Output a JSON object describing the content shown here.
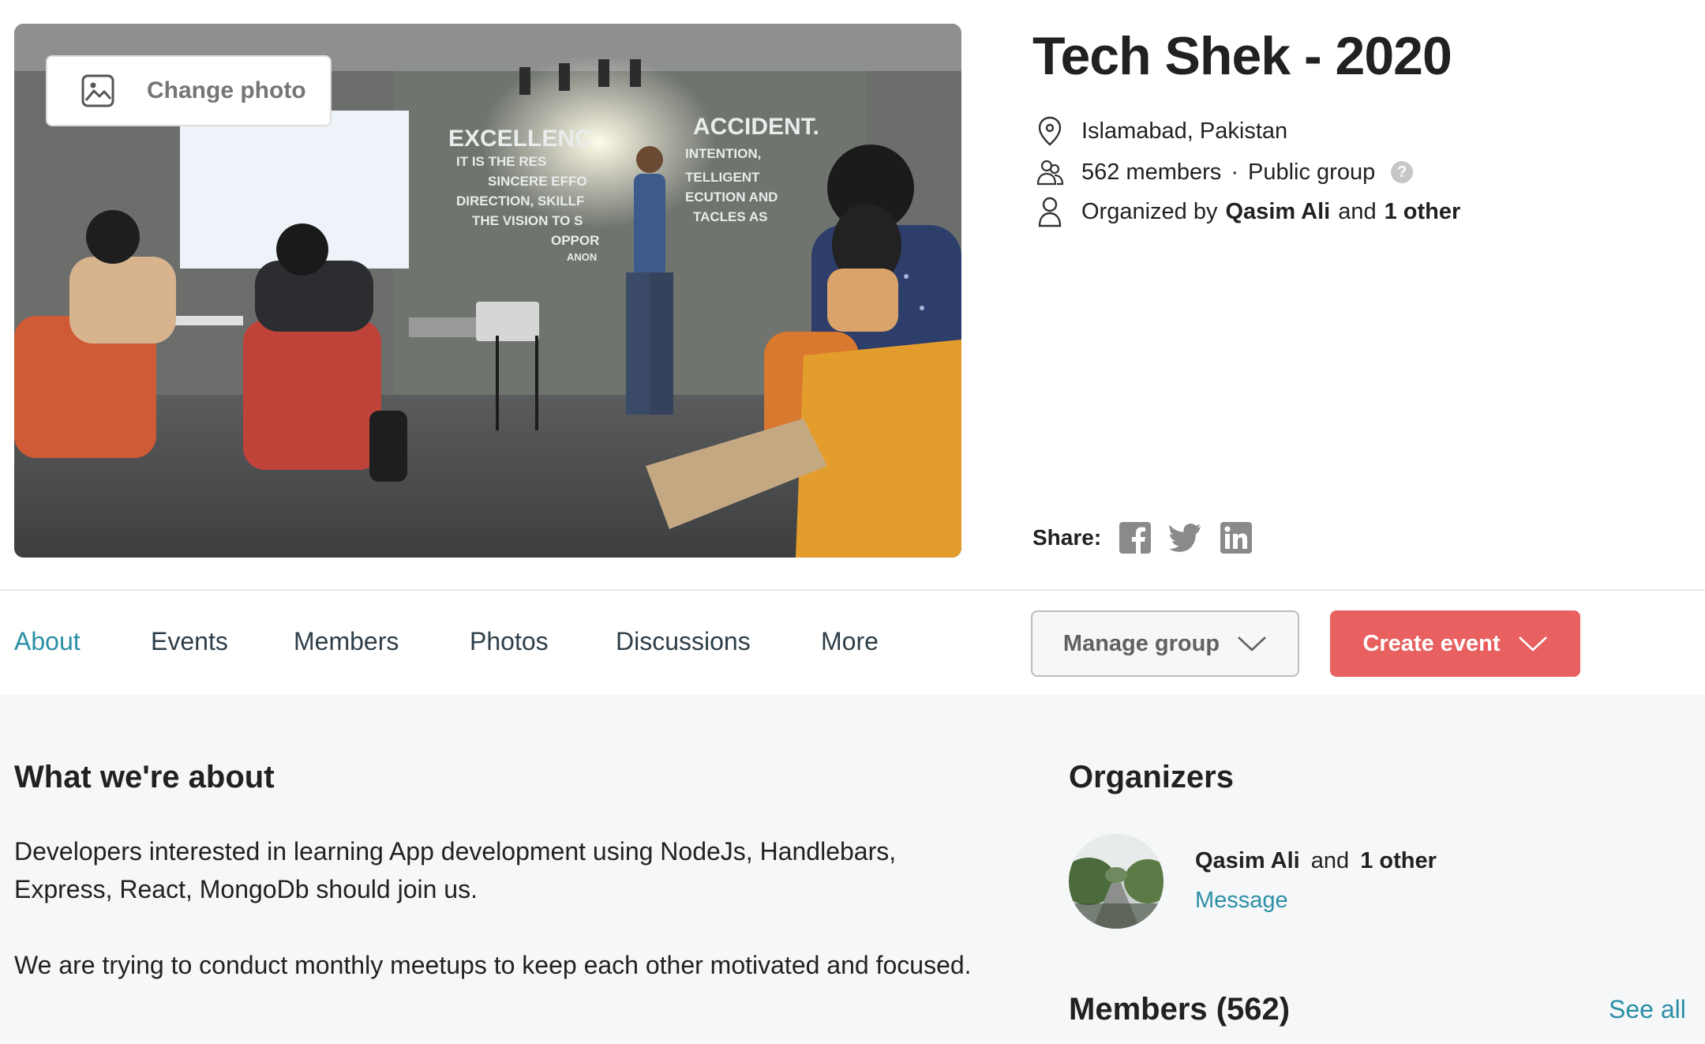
{
  "group": {
    "change_photo_label": "Change photo",
    "title": "Tech Shek - 2020",
    "location": "Islamabad, Pakistan",
    "members_count": "562 members",
    "separator": "·",
    "privacy": "Public group",
    "help_symbol": "?",
    "organized_prefix": "Organized by",
    "organizer_name": "Qasim Ali",
    "organized_and": "and",
    "organized_others": "1 other",
    "share_label": "Share:",
    "share_icons": [
      "facebook-icon",
      "twitter-icon",
      "linkedin-icon"
    ]
  },
  "tabs": [
    {
      "label": "About",
      "active": true
    },
    {
      "label": "Events",
      "active": false
    },
    {
      "label": "Members",
      "active": false
    },
    {
      "label": "Photos",
      "active": false
    },
    {
      "label": "Discussions",
      "active": false
    },
    {
      "label": "More",
      "active": false
    }
  ],
  "actions": {
    "manage_label": "Manage group",
    "create_label": "Create event"
  },
  "about": {
    "heading": "What we're about",
    "para1": "Developers interested in learning App development using NodeJs, Handlebars, Express, React, MongoDb should join us.",
    "para2": "We are trying to conduct monthly meetups to keep each other motivated and focused."
  },
  "organizers": {
    "heading": "Organizers",
    "name": "Qasim Ali",
    "and": "and",
    "others": "1 other",
    "message_label": "Message"
  },
  "members_section": {
    "heading": "Members (562)",
    "see_all_label": "See all"
  },
  "colors": {
    "accent": "#2a8fa6",
    "create_button": "#e86060",
    "content_bg": "#f6f7f8"
  }
}
